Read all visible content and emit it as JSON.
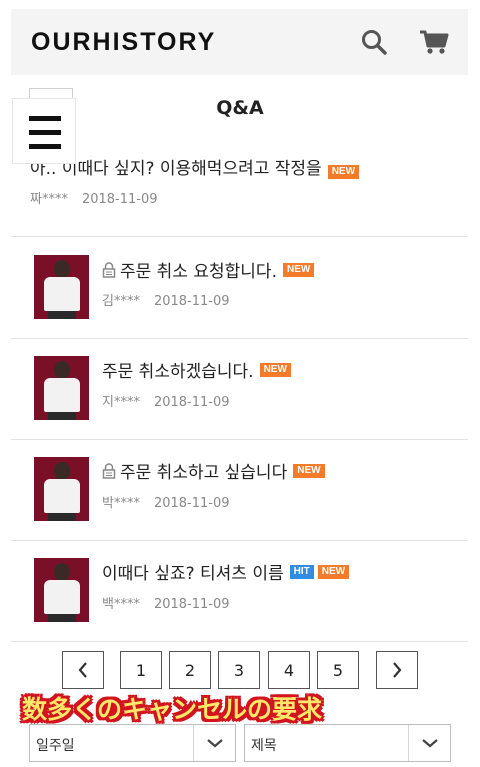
{
  "header": {
    "logo": "OURHISTORY",
    "icons": [
      "search-icon",
      "cart-icon"
    ]
  },
  "page": {
    "title": "Q&A"
  },
  "posts": [
    {
      "title": "아.. 이때다 싶지? 이용해먹으려고 작정을",
      "author": "짜****",
      "date": "2018-11-09",
      "locked": false,
      "badges": [
        "NEW"
      ]
    },
    {
      "title": "주문 취소 요청합니다.",
      "author": "김****",
      "date": "2018-11-09",
      "locked": true,
      "badges": [
        "NEW"
      ]
    },
    {
      "title": "주문 취소하겠습니다.",
      "author": "지****",
      "date": "2018-11-09",
      "locked": false,
      "badges": [
        "NEW"
      ]
    },
    {
      "title": "주문 취소하고 싶습니다",
      "author": "박****",
      "date": "2018-11-09",
      "locked": true,
      "badges": [
        "NEW"
      ]
    },
    {
      "title": "이때다 싶죠? 티셔츠 이름",
      "author": "백****",
      "date": "2018-11-09",
      "locked": false,
      "badges": [
        "HIT",
        "NEW"
      ]
    }
  ],
  "pagination": {
    "prev": "‹",
    "next": "›",
    "pages": [
      "1",
      "2",
      "3",
      "4",
      "5"
    ]
  },
  "overlay": {
    "caption": "数多くのキャンセルの要求"
  },
  "filters": {
    "period": "일주일",
    "field": "제목"
  },
  "colors": {
    "badge_new": "#f47b2a",
    "badge_hit": "#2f8de4",
    "thumb_bg": "#7a1028",
    "caption_fill": "#ffe86a",
    "caption_outline": "#d2141e"
  }
}
